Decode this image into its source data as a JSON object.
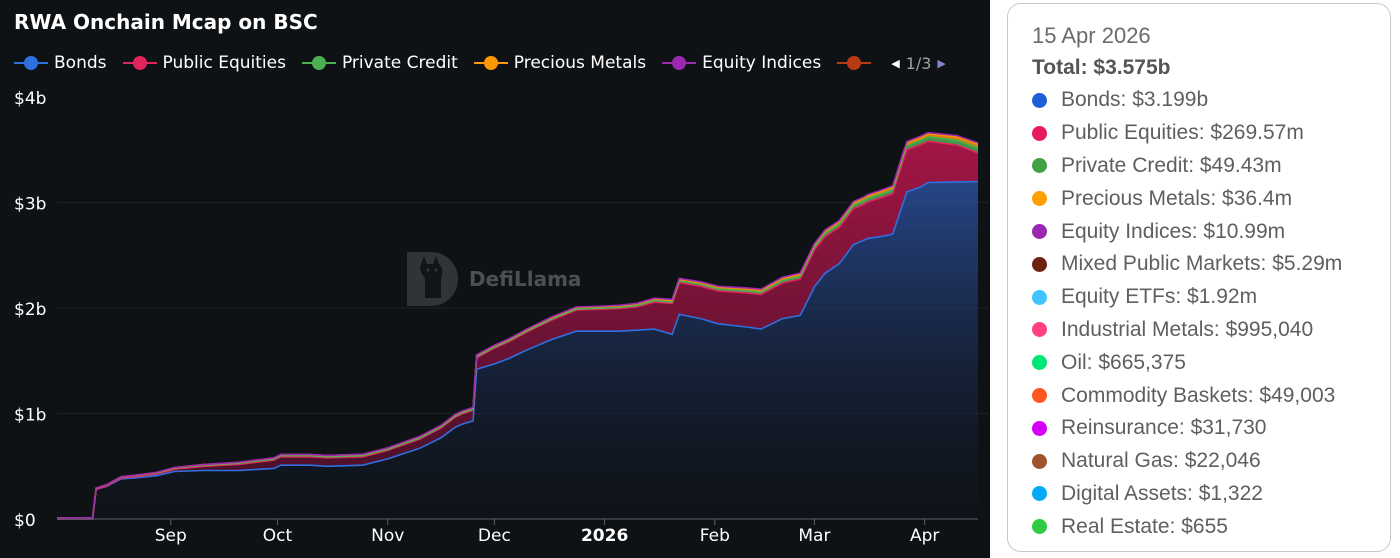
{
  "chart_data": {
    "type": "area",
    "title": "RWA Onchain Mcap on BSC",
    "legend": {
      "position": "top-left",
      "visible_items": [
        "Bonds",
        "Public Equities",
        "Private Credit",
        "Precious Metals",
        "Equity Indices",
        ""
      ],
      "pager": "1/3"
    },
    "watermark": "DefiLlama",
    "y_ticks": [
      "$4b",
      "$3b",
      "$2b",
      "$1b",
      "$0"
    ],
    "ylim": [
      0,
      4
    ],
    "y_unit": "billions USD",
    "x_ticks": [
      {
        "label": "Sep",
        "date": "2025-09-01",
        "bold": false
      },
      {
        "label": "Oct",
        "date": "2025-10-01",
        "bold": false
      },
      {
        "label": "Nov",
        "date": "2025-11-01",
        "bold": false
      },
      {
        "label": "Dec",
        "date": "2025-12-01",
        "bold": false
      },
      {
        "label": "2026",
        "date": "2026-01-01",
        "bold": true
      },
      {
        "label": "Feb",
        "date": "2026-02-01",
        "bold": false
      },
      {
        "label": "Mar",
        "date": "2026-03-01",
        "bold": false
      },
      {
        "label": "Apr",
        "date": "2026-04-01",
        "bold": false
      }
    ],
    "xlim": [
      "2025-07-31",
      "2026-04-16"
    ],
    "series": [
      {
        "name": "Bonds",
        "color": "#2f6fe0",
        "points": [
          [
            "2025-07-31",
            0.0
          ],
          [
            "2025-08-10",
            0.0
          ],
          [
            "2025-08-11",
            0.28
          ],
          [
            "2025-08-14",
            0.31
          ],
          [
            "2025-08-18",
            0.38
          ],
          [
            "2025-08-22",
            0.39
          ],
          [
            "2025-08-28",
            0.41
          ],
          [
            "2025-09-02",
            0.45
          ],
          [
            "2025-09-10",
            0.46
          ],
          [
            "2025-09-20",
            0.46
          ],
          [
            "2025-09-30",
            0.48
          ],
          [
            "2025-10-02",
            0.51
          ],
          [
            "2025-10-10",
            0.51
          ],
          [
            "2025-10-15",
            0.5
          ],
          [
            "2025-10-25",
            0.51
          ],
          [
            "2025-11-01",
            0.57
          ],
          [
            "2025-11-10",
            0.67
          ],
          [
            "2025-11-16",
            0.77
          ],
          [
            "2025-11-20",
            0.87
          ],
          [
            "2025-11-22",
            0.9
          ],
          [
            "2025-11-25",
            0.93
          ],
          [
            "2025-11-26",
            1.42
          ],
          [
            "2025-12-01",
            1.47
          ],
          [
            "2025-12-05",
            1.52
          ],
          [
            "2025-12-10",
            1.6
          ],
          [
            "2025-12-17",
            1.7
          ],
          [
            "2025-12-24",
            1.78
          ],
          [
            "2026-01-05",
            1.78
          ],
          [
            "2026-01-15",
            1.8
          ],
          [
            "2026-01-20",
            1.75
          ],
          [
            "2026-01-22",
            1.94
          ],
          [
            "2026-01-28",
            1.9
          ],
          [
            "2026-02-02",
            1.85
          ],
          [
            "2026-02-10",
            1.82
          ],
          [
            "2026-02-14",
            1.8
          ],
          [
            "2026-02-20",
            1.9
          ],
          [
            "2026-02-25",
            1.93
          ],
          [
            "2026-03-01",
            2.2
          ],
          [
            "2026-03-04",
            2.33
          ],
          [
            "2026-03-08",
            2.42
          ],
          [
            "2026-03-12",
            2.6
          ],
          [
            "2026-03-16",
            2.66
          ],
          [
            "2026-03-20",
            2.68
          ],
          [
            "2026-03-23",
            2.7
          ],
          [
            "2026-03-27",
            3.1
          ],
          [
            "2026-03-31",
            3.15
          ],
          [
            "2026-04-02",
            3.19
          ],
          [
            "2026-04-16",
            3.199
          ]
        ]
      },
      {
        "name": "Public Equities",
        "color": "#e0245e",
        "points": [
          [
            "2025-07-31",
            0.0
          ],
          [
            "2025-08-10",
            0.0
          ],
          [
            "2025-09-01",
            0.02
          ],
          [
            "2025-10-01",
            0.08
          ],
          [
            "2025-11-01",
            0.08
          ],
          [
            "2025-11-25",
            0.1
          ],
          [
            "2025-12-01",
            0.15
          ],
          [
            "2025-12-24",
            0.2
          ],
          [
            "2026-01-10",
            0.22
          ],
          [
            "2026-01-21",
            0.3
          ],
          [
            "2026-02-01",
            0.31
          ],
          [
            "2026-02-15",
            0.33
          ],
          [
            "2026-03-01",
            0.35
          ],
          [
            "2026-03-15",
            0.34
          ],
          [
            "2026-03-26",
            0.4
          ],
          [
            "2026-03-31",
            0.4
          ],
          [
            "2026-04-10",
            0.35
          ],
          [
            "2026-04-16",
            0.27
          ]
        ]
      },
      {
        "name": "Private Credit",
        "color": "#4caf50",
        "points": [
          [
            "2025-07-31",
            0.01
          ],
          [
            "2026-01-01",
            0.01
          ],
          [
            "2026-02-15",
            0.02
          ],
          [
            "2026-03-31",
            0.04
          ],
          [
            "2026-04-16",
            0.049
          ]
        ]
      },
      {
        "name": "Precious Metals",
        "color": "#ff9800",
        "points": [
          [
            "2025-07-31",
            0.0
          ],
          [
            "2025-10-01",
            0.01
          ],
          [
            "2026-01-01",
            0.015
          ],
          [
            "2026-03-31",
            0.03
          ],
          [
            "2026-04-16",
            0.036
          ]
        ]
      },
      {
        "name": "Equity Indices",
        "color": "#9c27b0",
        "points": [
          [
            "2025-07-31",
            0.0
          ],
          [
            "2026-01-01",
            0.005
          ],
          [
            "2026-04-16",
            0.011
          ]
        ]
      }
    ],
    "tooltip": {
      "date": "15 Apr 2026",
      "total": "Total: $3.575b",
      "rows": [
        {
          "label": "Bonds: $3.199b",
          "color": "#1f5fd6"
        },
        {
          "label": "Public Equities: $269.57m",
          "color": "#e8195c"
        },
        {
          "label": "Private Credit: $49.43m",
          "color": "#43a047"
        },
        {
          "label": "Precious Metals: $36.4m",
          "color": "#ffa000"
        },
        {
          "label": "Equity Indices: $10.99m",
          "color": "#9c27b0"
        },
        {
          "label": "Mixed Public Markets: $5.29m",
          "color": "#6d2210"
        },
        {
          "label": "Equity ETFs: $1.92m",
          "color": "#40c4ff"
        },
        {
          "label": "Industrial Metals: $995,040",
          "color": "#ff4081"
        },
        {
          "label": "Oil: $665,375",
          "color": "#00e676"
        },
        {
          "label": "Commodity Baskets: $49,003",
          "color": "#ff5722"
        },
        {
          "label": "Reinsurance: $31,730",
          "color": "#d500f9"
        },
        {
          "label": "Natural Gas: $22,046",
          "color": "#a0522d"
        },
        {
          "label": "Digital Assets: $1,322",
          "color": "#03a9f4"
        },
        {
          "label": "Real Estate: $655",
          "color": "#2ecc40"
        }
      ]
    }
  },
  "legend_extra_color": "#b83a14"
}
